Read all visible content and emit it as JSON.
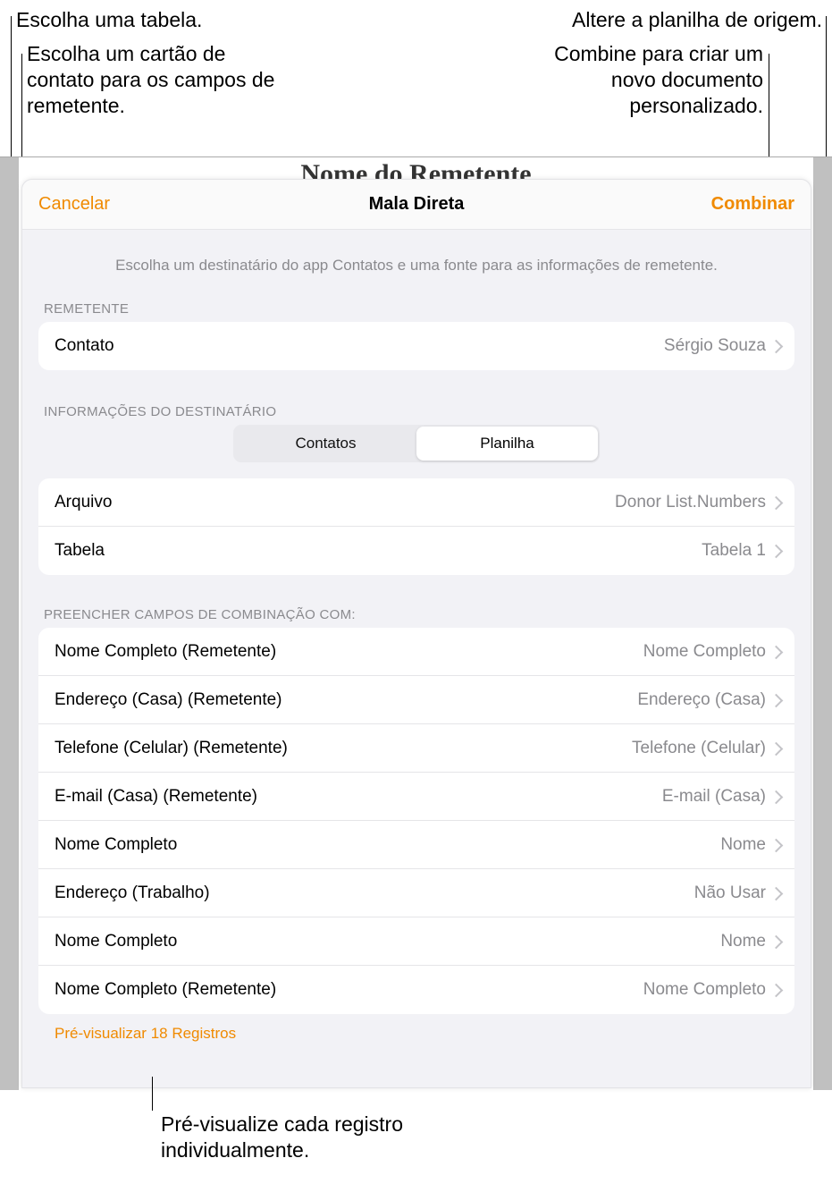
{
  "callouts": {
    "top_left_1": "Escolha uma tabela.",
    "top_left_2": "Escolha um cartão de contato para os campos de remetente.",
    "top_right_1": "Altere a planilha de origem.",
    "top_right_2": "Combine para criar um novo documento personalizado.",
    "bottom": "Pré-visualize cada registro individualmente."
  },
  "document_title_behind": "Nome do Remetente",
  "sheet": {
    "cancel": "Cancelar",
    "title": "Mala Direta",
    "combine": "Combinar",
    "description": "Escolha um destinatário do app Contatos e uma fonte para as informações de remetente.",
    "sender_header": "REMETENTE",
    "sender_row": {
      "label": "Contato",
      "value": "Sérgio Souza"
    },
    "recipient_header": "INFORMAÇÕES DO DESTINATÁRIO",
    "segments": {
      "contacts": "Contatos",
      "spreadsheet": "Planilha"
    },
    "file_row": {
      "label": "Arquivo",
      "value": "Donor List.Numbers"
    },
    "table_row": {
      "label": "Tabela",
      "value": "Tabela 1"
    },
    "fields_header": "PREENCHER CAMPOS DE COMBINAÇÃO COM:",
    "fields": [
      {
        "label": "Nome Completo (Remetente)",
        "value": "Nome Completo"
      },
      {
        "label": "Endereço (Casa) (Remetente)",
        "value": "Endereço (Casa)"
      },
      {
        "label": "Telefone (Celular) (Remetente)",
        "value": "Telefone (Celular)"
      },
      {
        "label": "E-mail (Casa) (Remetente)",
        "value": "E-mail (Casa)"
      },
      {
        "label": "Nome Completo",
        "value": "Nome"
      },
      {
        "label": "Endereço (Trabalho)",
        "value": "Não Usar"
      },
      {
        "label": "Nome Completo",
        "value": "Nome"
      },
      {
        "label": "Nome Completo (Remetente)",
        "value": "Nome Completo"
      }
    ],
    "preview_link": "Pré-visualizar 18 Registros"
  }
}
